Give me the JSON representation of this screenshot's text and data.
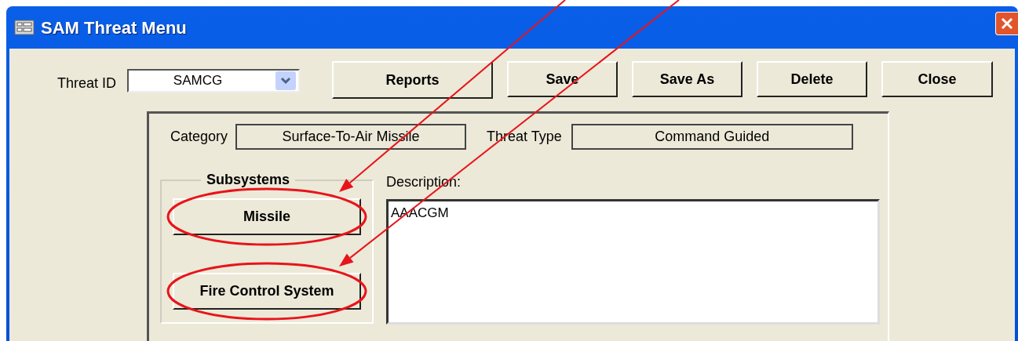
{
  "window": {
    "title": "SAM Threat Menu"
  },
  "threat_id": {
    "label": "Threat ID",
    "value": "SAMCG"
  },
  "toolbar_buttons": [
    "Reports",
    "Save",
    "Save As",
    "Delete",
    "Close"
  ],
  "category": {
    "label": "Category",
    "value": "Surface-To-Air Missile"
  },
  "threat_type": {
    "label": "Threat Type",
    "value": "Command Guided"
  },
  "subsystems": {
    "title": "Subsystems",
    "buttons": [
      {
        "label": "Missile",
        "highlighted": true
      },
      {
        "label": "Fire Control System",
        "highlighted": true
      }
    ]
  },
  "description": {
    "label": "Description:",
    "value": "AAACGM"
  }
}
